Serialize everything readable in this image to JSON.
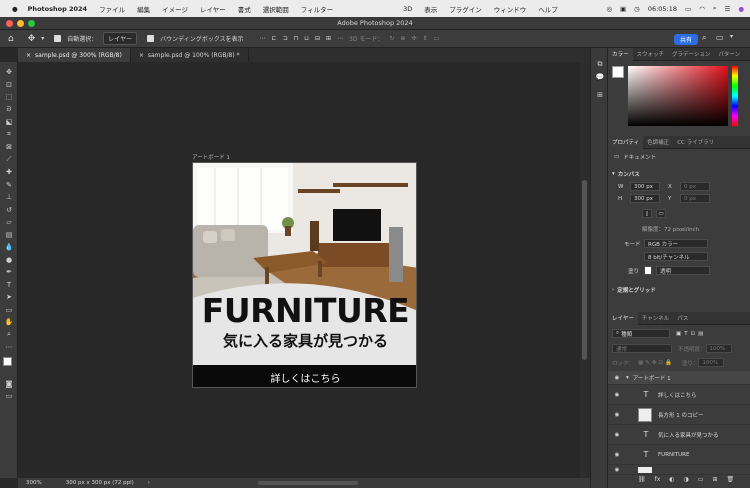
{
  "menubar": {
    "app_name": "Photoshop 2024",
    "items": [
      "ファイル",
      "編集",
      "イメージ",
      "レイヤー",
      "書式",
      "選択範囲",
      "フィルター",
      "3D",
      "表示",
      "プラグイン",
      "ウィンドウ",
      "ヘルプ"
    ],
    "clock": "06:05:18"
  },
  "window": {
    "title": "Adobe Photoshop 2024"
  },
  "options": {
    "auto_select_label": "自動選択：",
    "auto_select_value": "レイヤー",
    "bbox_label": "バウンディングボックスを表示",
    "mode_3d": "3D モード：",
    "share_label": "共有"
  },
  "tabs": [
    {
      "label": "sample.psd @ 300% (RGB/8)"
    },
    {
      "label": "sample.psd @ 100% (RGB/8) *"
    }
  ],
  "artboard": {
    "label": "アートボード 1",
    "headline": "FURNITURE",
    "subline": "気に入る家具が見つかる",
    "cta": "詳しくはこちら"
  },
  "status": {
    "zoom": "300%",
    "doc_info": "300 px x 300 px (72 ppi)"
  },
  "color_panel": {
    "tabs": [
      "カラー",
      "スウォッチ",
      "グラデーション",
      "パターン"
    ],
    "fg_color": "#ffffff",
    "bg_color": "#c8141e"
  },
  "properties": {
    "tabs": [
      "プロパティ",
      "色調補正",
      "CC ライブラリ"
    ],
    "doc_label": "ドキュメント",
    "canvas_title": "カンバス",
    "w_label": "W",
    "w_value": "300 px",
    "h_label": "H",
    "h_value": "300 px",
    "x_label": "X",
    "x_value": "0 px",
    "y_label": "Y",
    "y_value": "0 px",
    "resolution": "解像度：72 pixel/inch",
    "mode_label": "モード",
    "mode_value": "RGB カラー",
    "depth_value": "8 bit/チャンネル",
    "fill_label": "塗り",
    "fill_value": "透明",
    "rulers_title": "定規とグリッド"
  },
  "layers_panel": {
    "tabs": [
      "レイヤー",
      "チャンネル",
      "パス"
    ],
    "kind_label": "種類",
    "blend_mode": "通常",
    "opacity_label": "不透明度：",
    "opacity_value": "100%",
    "lock_label": "ロック：",
    "fill_label": "塗り：",
    "fill_value": "100%",
    "layers": [
      {
        "name": "アートボード 1",
        "type": "group"
      },
      {
        "name": "詳しくはこちら",
        "type": "text"
      },
      {
        "name": "長方形 1 のコピー",
        "type": "shape"
      },
      {
        "name": "気に入る家具が見つかる",
        "type": "text"
      },
      {
        "name": "FURNITURE",
        "type": "text"
      }
    ]
  },
  "icons": {
    "tools": [
      "move-tool",
      "artboard-tool",
      "marquee-tool",
      "lasso-tool",
      "object-select-tool",
      "crop-tool",
      "frame-tool",
      "eyedropper-tool",
      "healing-tool",
      "brush-tool",
      "stamp-tool",
      "history-brush-tool",
      "eraser-tool",
      "gradient-tool",
      "blur-tool",
      "dodge-tool",
      "pen-tool",
      "type-tool",
      "path-select-tool",
      "rectangle-tool",
      "hand-tool",
      "zoom-tool"
    ]
  }
}
